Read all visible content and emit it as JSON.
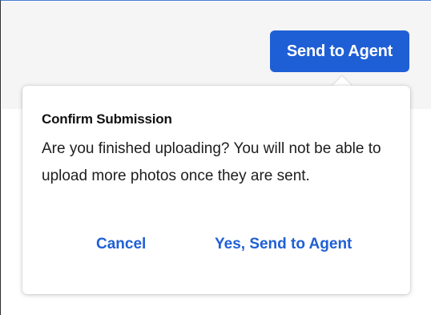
{
  "header": {
    "send_button_label": "Send to Agent"
  },
  "dialog": {
    "title": "Confirm Submission",
    "message": "Are you finished uploading? You will not be able to upload more photos once they are sent.",
    "cancel_label": "Cancel",
    "confirm_label": "Yes, Send to Agent"
  },
  "colors": {
    "accent": "#1f5fd6",
    "header_background": "#f5f5f5"
  }
}
